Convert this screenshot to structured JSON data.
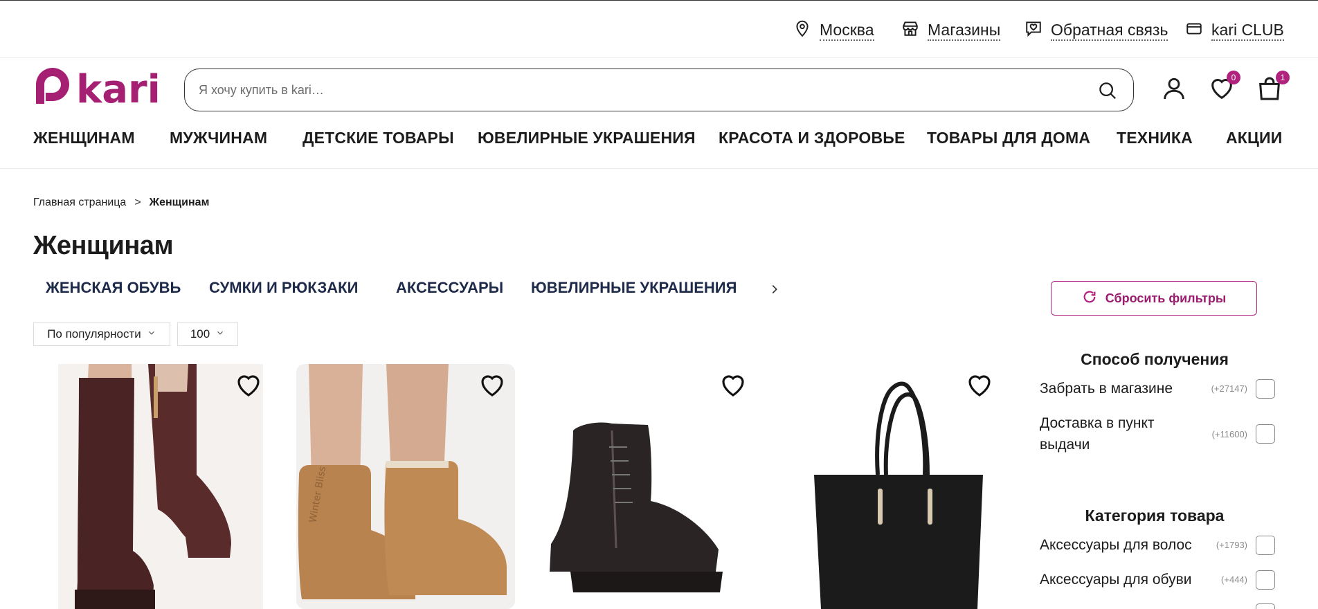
{
  "topbar": {
    "city": "Москва",
    "stores": "Магазины",
    "feedback": "Обратная связь",
    "club": "kari CLUB"
  },
  "header": {
    "logo_text": "kari",
    "search_placeholder": "Я хочу купить в kari…",
    "favorites_count": "0",
    "cart_count": "1"
  },
  "nav": [
    "ЖЕНЩИНАМ",
    "МУЖЧИНАМ",
    "ДЕТСКИЕ ТОВАРЫ",
    "ЮВЕЛИРНЫЕ УКРАШЕНИЯ",
    "КРАСОТА И ЗДОРОВЬЕ",
    "ТОВАРЫ ДЛЯ ДОМА",
    "ТЕХНИКА",
    "АКЦИИ"
  ],
  "breadcrumb": {
    "home": "Главная страница",
    "separator": ">",
    "current": "Женщинам"
  },
  "page_title": "Женщинам",
  "subcategories": [
    "ЖЕНСКАЯ ОБУВЬ",
    "СУМКИ И РЮКЗАКИ",
    "АКСЕССУАРЫ",
    "ЮВЕЛИРНЫЕ УКРАШЕНИЯ"
  ],
  "reset_filters": "Сбросить фильтры",
  "sort": {
    "order": "По популярности",
    "per_page": "100"
  },
  "products": [
    {
      "kind": "tall-boots",
      "color": "#4a2424"
    },
    {
      "kind": "ugg-boots",
      "color": "#b9834f"
    },
    {
      "kind": "ankle-boots",
      "color": "#2b2424"
    },
    {
      "kind": "tote-bag",
      "color": "#1b1b1b"
    }
  ],
  "filters": {
    "delivery": {
      "title": "Способ получения",
      "options": [
        {
          "label": "Забрать в магазине",
          "count": "(+27147)"
        },
        {
          "label": "Доставка в пункт выдачи",
          "count": "(+11600)"
        }
      ]
    },
    "category": {
      "title": "Категория товара",
      "options": [
        {
          "label": "Аксессуары для волос",
          "count": "(+1793)"
        },
        {
          "label": "Аксессуары для обуви",
          "count": "(+444)"
        }
      ]
    }
  },
  "colors": {
    "brand": "#b0227d",
    "text": "#1c1c1c",
    "subtab": "#1e2a4a"
  }
}
